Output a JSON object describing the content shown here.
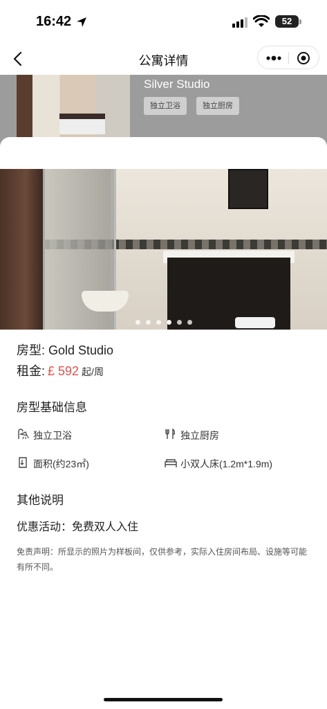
{
  "status_bar": {
    "time": "16:42",
    "battery": "52"
  },
  "nav": {
    "title": "公寓详情"
  },
  "background_card": {
    "title": "Silver Studio",
    "tags": [
      "独立卫浴",
      "独立厨房"
    ]
  },
  "gallery": {
    "slide_count": 6,
    "active_index": 3
  },
  "detail": {
    "room_type_label": "房型: Gold Studio",
    "rent_label": "租金:",
    "rent_price": "£ 592",
    "rent_unit": "起/周"
  },
  "basic_info": {
    "title": "房型基础信息",
    "features": [
      {
        "icon": "shower-icon",
        "label": "独立卫浴"
      },
      {
        "icon": "utensils-icon",
        "label": "独立厨房"
      },
      {
        "icon": "area-icon",
        "label": "面积(约23㎡)"
      },
      {
        "icon": "bed-icon",
        "label": "小双人床(1.2m*1.9m)"
      }
    ]
  },
  "other_info": {
    "title": "其他说明",
    "promo": "优惠活动：免费双人入住",
    "disclaimer": "免责声明：所显示的照片为样板间，仅供参考，实际入住房间布局、设施等可能有所不同。"
  }
}
